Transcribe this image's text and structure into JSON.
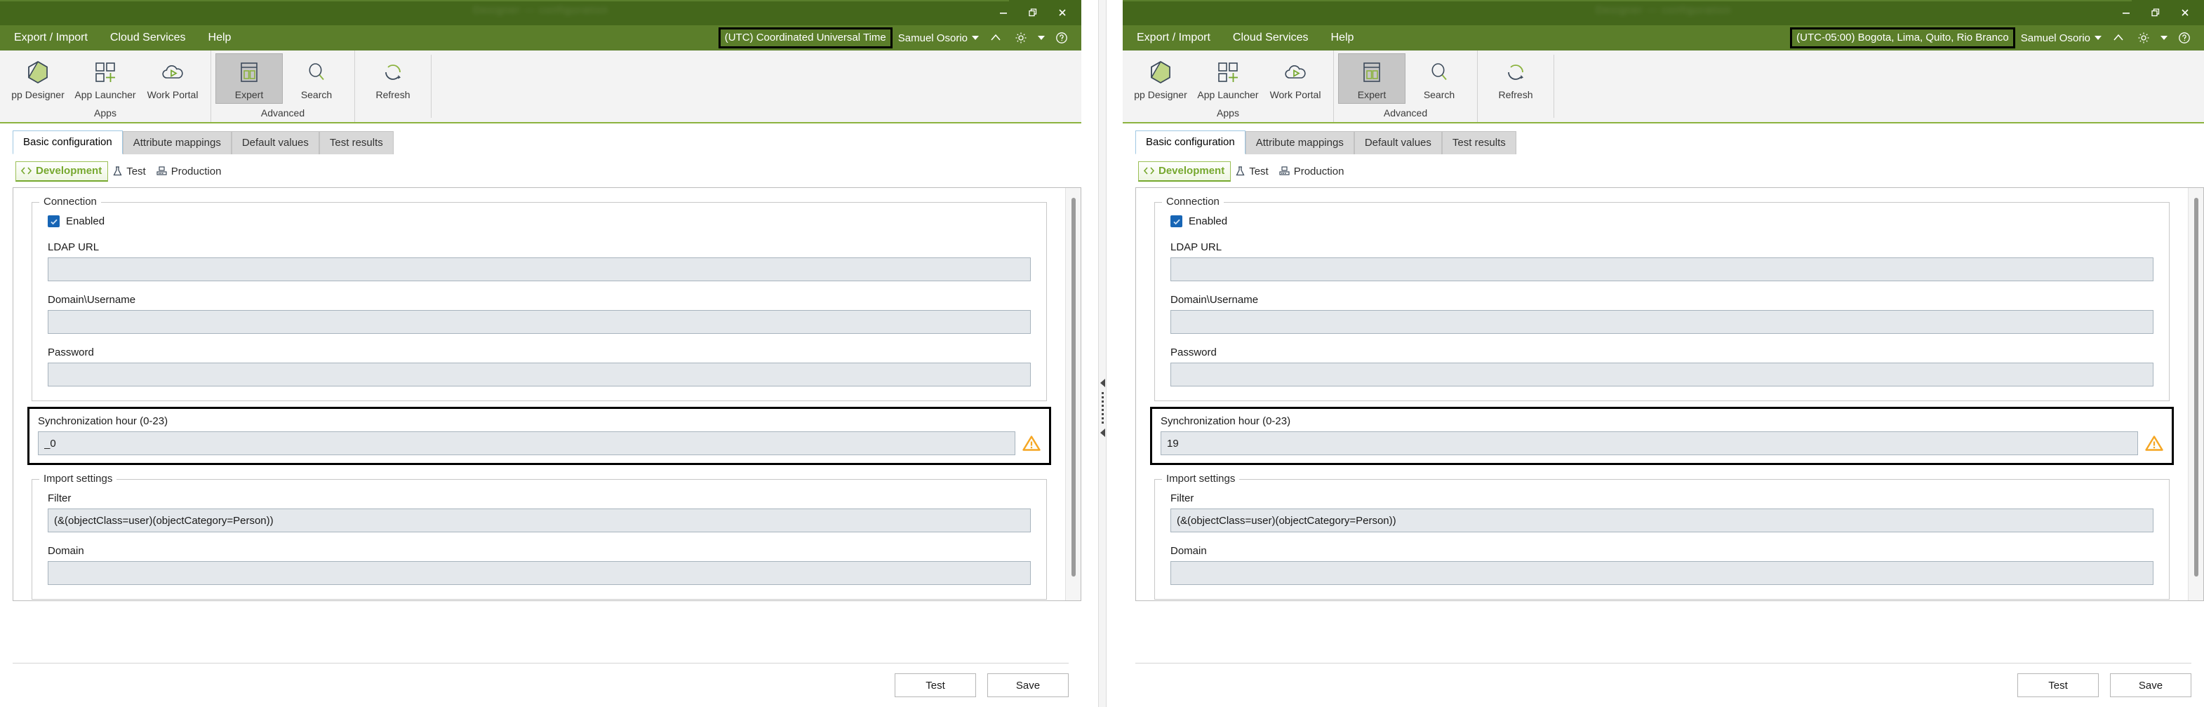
{
  "panels": [
    {
      "id": "left",
      "titlebar": {
        "blurred_title": "Designer — configuration",
        "minimize_label": "Minimize",
        "restore_label": "Restore",
        "close_label": "Close"
      },
      "menubar": {
        "items": [
          {
            "label": "Export / Import"
          },
          {
            "label": "Cloud Services"
          },
          {
            "label": "Help"
          }
        ],
        "timezone": "(UTC) Coordinated Universal Time",
        "timezone_highlighted": true,
        "user": "Samuel Osorio",
        "icons": [
          "chevron-up-icon",
          "gear-icon",
          "caret-down-icon",
          "help-icon"
        ]
      },
      "ribbon": {
        "groups": [
          {
            "label": "Apps",
            "buttons": [
              {
                "label": "pp Designer",
                "icon": "hexagon-designer-icon",
                "active": false
              },
              {
                "label": "App Launcher",
                "icon": "grid-plus-icon",
                "active": false
              },
              {
                "label": "Work Portal",
                "icon": "cloud-play-icon",
                "active": false
              }
            ]
          },
          {
            "label": "Advanced",
            "buttons": [
              {
                "label": "Expert",
                "icon": "layout-panes-icon",
                "active": true
              },
              {
                "label": "Search",
                "icon": "magnifier-icon",
                "active": false
              }
            ]
          },
          {
            "label": "",
            "buttons": [
              {
                "label": "Refresh",
                "icon": "refresh-icon",
                "active": false
              }
            ]
          }
        ]
      },
      "tabs": [
        {
          "label": "Basic configuration",
          "selected": true
        },
        {
          "label": "Attribute mappings",
          "selected": false
        },
        {
          "label": "Default values",
          "selected": false
        },
        {
          "label": "Test results",
          "selected": false
        }
      ],
      "env_tabs": [
        {
          "label": "Development",
          "icon": "code-brackets-icon",
          "selected": true
        },
        {
          "label": "Test",
          "icon": "flask-icon",
          "selected": false
        },
        {
          "label": "Production",
          "icon": "server-rack-icon",
          "selected": false
        }
      ],
      "connection": {
        "title": "Connection",
        "enabled_label": "Enabled",
        "enabled_checked": true,
        "fields": [
          {
            "label": "LDAP URL",
            "value": "",
            "name": "ldap-url-input"
          },
          {
            "label": "Domain\\Username",
            "value": "",
            "name": "domain-username-input"
          },
          {
            "label": "Password",
            "value": "",
            "name": "password-input"
          }
        ]
      },
      "sync_hour": {
        "label": "Synchronization hour (0-23)",
        "value": "_0",
        "highlighted": true,
        "warning_icon": "warning-triangle-icon"
      },
      "import_settings": {
        "title": "Import settings",
        "fields": [
          {
            "label": "Filter",
            "value": "(&(objectClass=user)(objectCategory=Person))",
            "name": "filter-input"
          },
          {
            "label": "Domain",
            "value": "",
            "name": "import-domain-input"
          }
        ]
      },
      "footer": {
        "test_label": "Test",
        "save_label": "Save"
      }
    },
    {
      "id": "right",
      "titlebar": {
        "blurred_title": "Designer — configuration",
        "minimize_label": "Minimize",
        "restore_label": "Restore",
        "close_label": "Close"
      },
      "menubar": {
        "items": [
          {
            "label": "Export / Import"
          },
          {
            "label": "Cloud Services"
          },
          {
            "label": "Help"
          }
        ],
        "timezone": "(UTC-05:00) Bogota, Lima, Quito, Rio Branco",
        "timezone_highlighted": true,
        "user": "Samuel Osorio",
        "icons": [
          "chevron-up-icon",
          "gear-icon",
          "caret-down-icon",
          "help-icon"
        ]
      },
      "ribbon": {
        "groups": [
          {
            "label": "Apps",
            "buttons": [
              {
                "label": "pp Designer",
                "icon": "hexagon-designer-icon",
                "active": false
              },
              {
                "label": "App Launcher",
                "icon": "grid-plus-icon",
                "active": false
              },
              {
                "label": "Work Portal",
                "icon": "cloud-play-icon",
                "active": false
              }
            ]
          },
          {
            "label": "Advanced",
            "buttons": [
              {
                "label": "Expert",
                "icon": "layout-panes-icon",
                "active": true
              },
              {
                "label": "Search",
                "icon": "magnifier-icon",
                "active": false
              }
            ]
          },
          {
            "label": "",
            "buttons": [
              {
                "label": "Refresh",
                "icon": "refresh-icon",
                "active": false
              }
            ]
          }
        ]
      },
      "tabs": [
        {
          "label": "Basic configuration",
          "selected": true
        },
        {
          "label": "Attribute mappings",
          "selected": false
        },
        {
          "label": "Default values",
          "selected": false
        },
        {
          "label": "Test results",
          "selected": false
        }
      ],
      "env_tabs": [
        {
          "label": "Development",
          "icon": "code-brackets-icon",
          "selected": true
        },
        {
          "label": "Test",
          "icon": "flask-icon",
          "selected": false
        },
        {
          "label": "Production",
          "icon": "server-rack-icon",
          "selected": false
        }
      ],
      "connection": {
        "title": "Connection",
        "enabled_label": "Enabled",
        "enabled_checked": true,
        "fields": [
          {
            "label": "LDAP URL",
            "value": "",
            "name": "ldap-url-input"
          },
          {
            "label": "Domain\\Username",
            "value": "",
            "name": "domain-username-input"
          },
          {
            "label": "Password",
            "value": "",
            "name": "password-input"
          }
        ]
      },
      "sync_hour": {
        "label": "Synchronization hour (0-23)",
        "value": "19",
        "highlighted": true,
        "warning_icon": "warning-triangle-icon"
      },
      "import_settings": {
        "title": "Import settings",
        "fields": [
          {
            "label": "Filter",
            "value": "(&(objectClass=user)(objectCategory=Person))",
            "name": "filter-input"
          },
          {
            "label": "Domain",
            "value": "",
            "name": "import-domain-input"
          }
        ]
      },
      "footer": {
        "test_label": "Test",
        "save_label": "Save"
      }
    }
  ],
  "colors": {
    "titlebar_green": "#44671b",
    "menubar_green": "#5b7e2a",
    "accent_green": "#8cb33f",
    "env_active_green": "#76a82e",
    "checkbox_blue": "#1765b5",
    "warning_orange": "#f5a623",
    "highlight_black": "#000000",
    "field_bg": "#e4e8ec"
  },
  "splitter": {
    "handle_icon": "collapse-left-arrow-icon"
  }
}
